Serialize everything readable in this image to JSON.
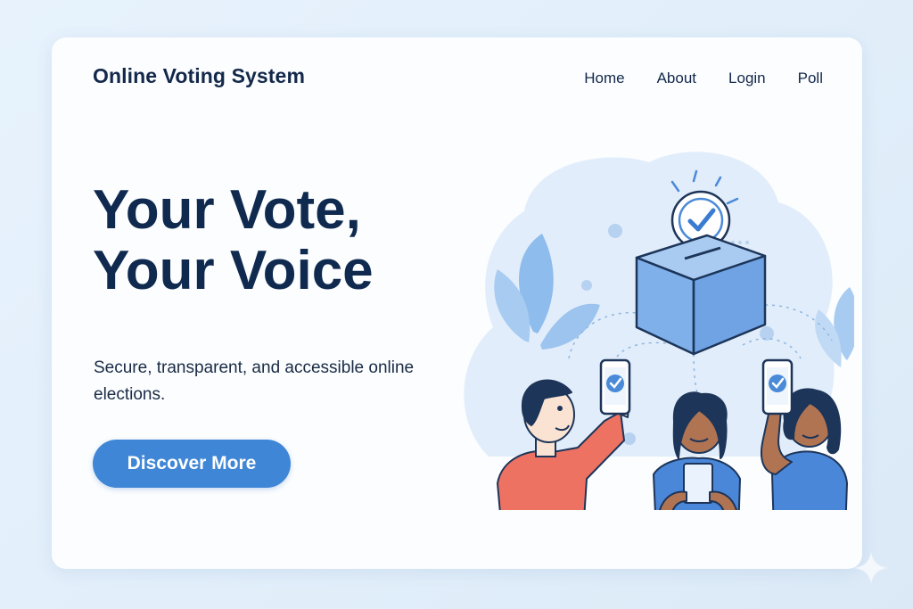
{
  "header": {
    "brand": "Online Voting System",
    "nav": [
      {
        "label": "Home"
      },
      {
        "label": "About"
      },
      {
        "label": "Login"
      },
      {
        "label": "Poll"
      }
    ]
  },
  "hero": {
    "title_line1": "Your Vote,",
    "title_line2": "Your Voice",
    "subtitle": "Secure, transparent, and accessible online elections.",
    "cta_label": "Discover More"
  },
  "illustration": {
    "icons": [
      "ballot-box-icon",
      "checkmark-icon",
      "smartphone-icon",
      "tablet-icon",
      "leaf-icon",
      "sparkle-icon"
    ]
  },
  "colors": {
    "page_background": "#e6f1fb",
    "card_background": "#fbfdff",
    "heading": "#102a4f",
    "accent": "#3f86d6",
    "ballot_box": "#7fb0ea",
    "shirt_red": "#ee7262",
    "shirt_blue": "#4a87d8"
  }
}
